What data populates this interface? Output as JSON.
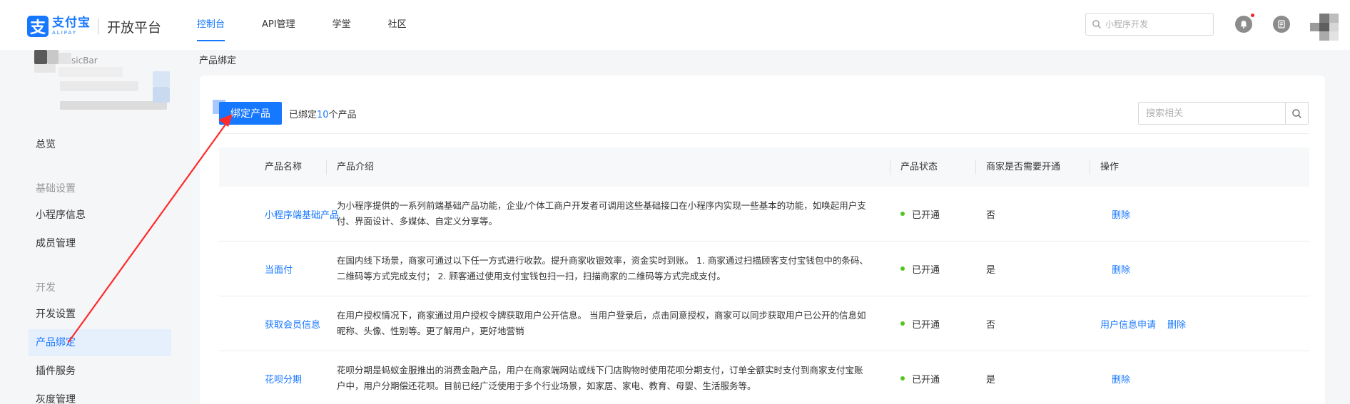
{
  "header": {
    "logo_cn": "支付宝",
    "logo_en": "ALIPAY",
    "logo_platform": "开放平台",
    "nav": [
      {
        "label": "控制台",
        "active": true
      },
      {
        "label": "API管理",
        "active": false
      },
      {
        "label": "学堂",
        "active": false
      },
      {
        "label": "社区",
        "active": false
      }
    ],
    "search_placeholder": "小程序开发",
    "icons": [
      "search-icon",
      "bell-icon",
      "document-icon",
      "avatar"
    ]
  },
  "sidebar": {
    "app_name_fragment": "sicBar",
    "items": [
      {
        "key": "overview",
        "label": "总览",
        "type": "item"
      },
      {
        "key": "basic",
        "label": "基础设置",
        "type": "group"
      },
      {
        "key": "miniapp-info",
        "label": "小程序信息",
        "type": "item"
      },
      {
        "key": "members",
        "label": "成员管理",
        "type": "item"
      },
      {
        "key": "dev",
        "label": "开发",
        "type": "group"
      },
      {
        "key": "dev-settings",
        "label": "开发设置",
        "type": "item"
      },
      {
        "key": "product-binding",
        "label": "产品绑定",
        "type": "item",
        "active": true
      },
      {
        "key": "plugin",
        "label": "插件服务",
        "type": "item"
      },
      {
        "key": "gray",
        "label": "灰度管理",
        "type": "item"
      }
    ]
  },
  "breadcrumb": "产品绑定",
  "toolbar": {
    "bind_button": "绑定产品",
    "bound_prefix": "已绑定",
    "bound_count": "10",
    "bound_suffix": "个产品",
    "search_placeholder": "搜索相关"
  },
  "table": {
    "columns": [
      "产品名称",
      "产品介绍",
      "产品状态",
      "商家是否需要开通",
      "操作"
    ],
    "rows": [
      {
        "name": "小程序端基础产品",
        "desc": "为小程序提供的一系列前端基础产品功能，企业/个体工商户开发者可调用这些基础接口在小程序内实现一些基本的功能，如唤起用户支付、界面设计、多媒体、自定义分享等。",
        "status": "已开通",
        "need_merchant": "否",
        "ops": [
          "删除"
        ]
      },
      {
        "name": "当面付",
        "desc": "在国内线下场景，商家可通过以下任一方式进行收款。提升商家收银效率，资金实时到账。 1. 商家通过扫描顾客支付宝钱包中的条码、二维码等方式完成支付； 2. 顾客通过使用支付宝钱包扫一扫，扫描商家的二维码等方式完成支付。",
        "status": "已开通",
        "need_merchant": "是",
        "ops": [
          "删除"
        ]
      },
      {
        "name": "获取会员信息",
        "desc": "在用户授权情况下，商家通过用户授权令牌获取用户公开信息。 当用户登录后，点击同意授权，商家可以同步获取用户已公开的信息如昵称、头像、性别等。更了解用户，更好地营销",
        "status": "已开通",
        "need_merchant": "否",
        "ops": [
          "用户信息申请",
          "删除"
        ]
      },
      {
        "name": "花呗分期",
        "desc": "花呗分期是蚂蚁金服推出的消费金融产品，用户在商家端网站或线下门店购物时使用花呗分期支付，订单全额实时支付到商家支付宝账户中，用户分期偿还花呗。目前已经广泛使用于多个行业场景，如家居、家电、教育、母婴、生活服务等。",
        "status": "已开通",
        "need_merchant": "是",
        "ops": [
          "删除"
        ]
      }
    ]
  },
  "colors": {
    "accent": "#1677ff",
    "active_bg": "#e6f0fd",
    "status_green": "#52c41a",
    "annotation_red": "#ff2a2a"
  }
}
